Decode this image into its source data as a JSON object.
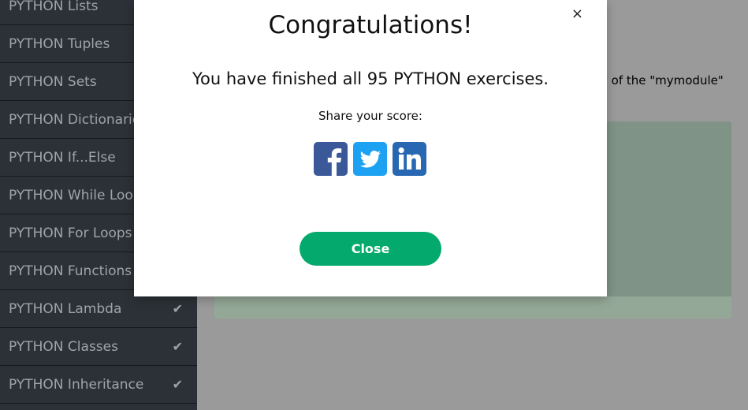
{
  "sidebar": {
    "items": [
      {
        "label": "PYTHON Lists",
        "checked": true
      },
      {
        "label": "PYTHON Tuples",
        "checked": true
      },
      {
        "label": "PYTHON Sets",
        "checked": true
      },
      {
        "label": "PYTHON Dictionaries",
        "checked": true
      },
      {
        "label": "PYTHON If...Else",
        "checked": true
      },
      {
        "label": "PYTHON While Loops",
        "checked": true
      },
      {
        "label": "PYTHON For Loops",
        "checked": true
      },
      {
        "label": "PYTHON Functions",
        "checked": true
      },
      {
        "label": "PYTHON Lambda",
        "checked": true
      },
      {
        "label": "PYTHON Classes",
        "checked": true
      },
      {
        "label": "PYTHON Inheritance",
        "checked": true
      }
    ],
    "check_icon": "✔"
  },
  "main": {
    "instruction_fragment": "y of the \"mymodule\""
  },
  "modal": {
    "close_x": "×",
    "title": "Congratulations!",
    "message": "You have finished all 95 PYTHON exercises.",
    "share_label": "Share your score:",
    "share": [
      {
        "name": "facebook",
        "icon": "facebook-icon",
        "color": "#3b5998"
      },
      {
        "name": "twitter",
        "icon": "twitter-icon",
        "color": "#1da1f2"
      },
      {
        "name": "linkedin",
        "icon": "linkedin-icon",
        "color": "#2867b2"
      }
    ],
    "close_label": "Close",
    "close_color": "#04aa6d"
  }
}
